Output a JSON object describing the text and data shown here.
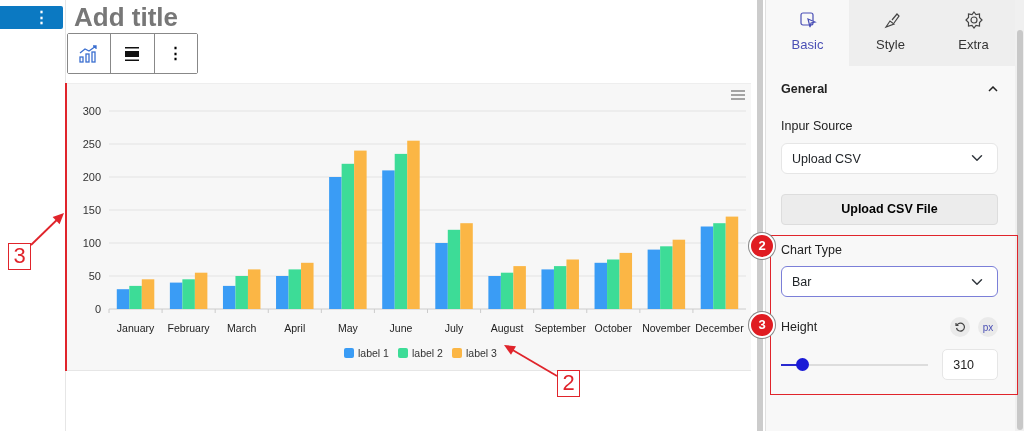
{
  "sidebar_button": {
    "label": "⋮"
  },
  "editor": {
    "title": {
      "placeholder": "Add title"
    },
    "toolbar": {
      "more_label": "⋮"
    },
    "chart": {
      "chart_data": {
        "type": "bar",
        "categories": [
          "January",
          "February",
          "March",
          "April",
          "May",
          "June",
          "July",
          "August",
          "September",
          "October",
          "November",
          "December"
        ],
        "series": [
          {
            "name": "label 1",
            "color": "#3a9cf5",
            "values": [
              30,
              40,
              35,
              50,
              200,
              210,
              100,
              50,
              60,
              70,
              90,
              125
            ]
          },
          {
            "name": "label 2",
            "color": "#3ddc97",
            "values": [
              35,
              45,
              50,
              60,
              220,
              235,
              120,
              55,
              65,
              75,
              95,
              130
            ]
          },
          {
            "name": "label 3",
            "color": "#fbb645",
            "values": [
              45,
              55,
              60,
              70,
              240,
              255,
              130,
              65,
              75,
              85,
              105,
              140
            ]
          }
        ],
        "grid": true,
        "legend": true,
        "ylim": [
          0,
          300
        ],
        "yticks": [
          0,
          50,
          100,
          150,
          200,
          250,
          300
        ]
      }
    }
  },
  "panel": {
    "tabs": [
      {
        "label": "Basic",
        "selected": true
      },
      {
        "label": "Style",
        "selected": false
      },
      {
        "label": "Extra",
        "selected": false
      }
    ],
    "section": {
      "title": "General",
      "expanded": true
    },
    "input_source": {
      "label": "Inpur Source",
      "value": "Upload CSV"
    },
    "upload_button": {
      "label": "Upload CSV File"
    },
    "chart_type": {
      "label": "Chart Type",
      "value": "Bar"
    },
    "height": {
      "label": "Height",
      "unit": "px",
      "level": 0.14,
      "value": "310"
    }
  },
  "annotations": {
    "callouts": [
      {
        "label": "3"
      },
      {
        "label": "2"
      }
    ],
    "badges": [
      {
        "label": "2"
      },
      {
        "label": "3"
      }
    ]
  }
}
